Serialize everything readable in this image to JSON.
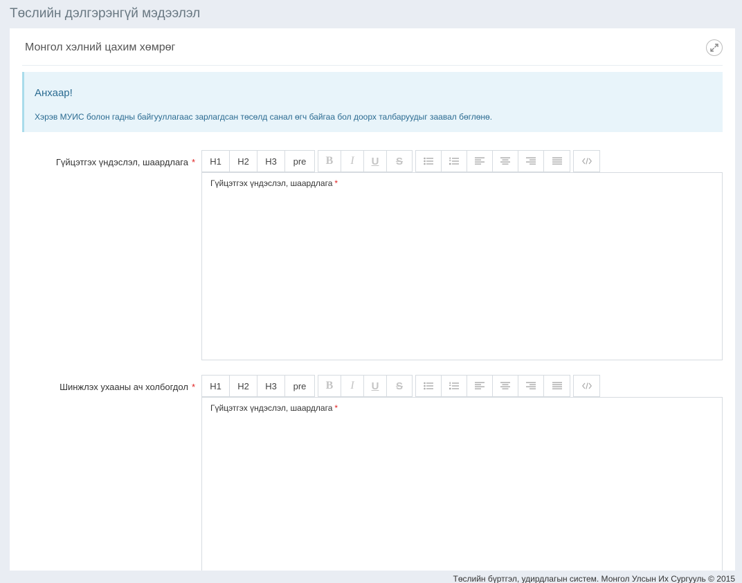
{
  "page": {
    "title": "Төслийн дэлгэрэнгүй мэдээлэл"
  },
  "panel": {
    "title": "Монгол хэлний цахим хөмрөг",
    "expand_icon": "expand-arrows-icon"
  },
  "alert": {
    "title": "Анхаар!",
    "text": "Хэрэв МУИС болон гадны байгууллагаас зарлагдсан төсөлд санал өгч байгаа бол доорх талбаруудыг заавал бөглөнө."
  },
  "toolbar": {
    "h1": "H1",
    "h2": "H2",
    "h3": "H3",
    "pre": "pre",
    "bold": "B",
    "italic": "I",
    "underline": "U",
    "strike": "S"
  },
  "fields": [
    {
      "label": "Гүйцэтгэх үндэслэл, шаардлага",
      "required_mark": "*",
      "editor_content": "Гүйцэтгэх үндэслэл, шаардлага",
      "editor_required_mark": "*"
    },
    {
      "label": "Шинжлэх ухааны ач холбогдол",
      "required_mark": "*",
      "editor_content": "Гүйцэтгэх үндэслэл, шаардлага",
      "editor_required_mark": "*"
    }
  ],
  "footer": {
    "text": "Төслийн бүртгэл, удирдлагын систем. Монгол Улсын Их Сургууль © 2015"
  },
  "colors": {
    "background": "#e9edf3",
    "alert_bg": "#e8f4fa",
    "alert_text": "#2b6b91",
    "required": "#e02222"
  }
}
